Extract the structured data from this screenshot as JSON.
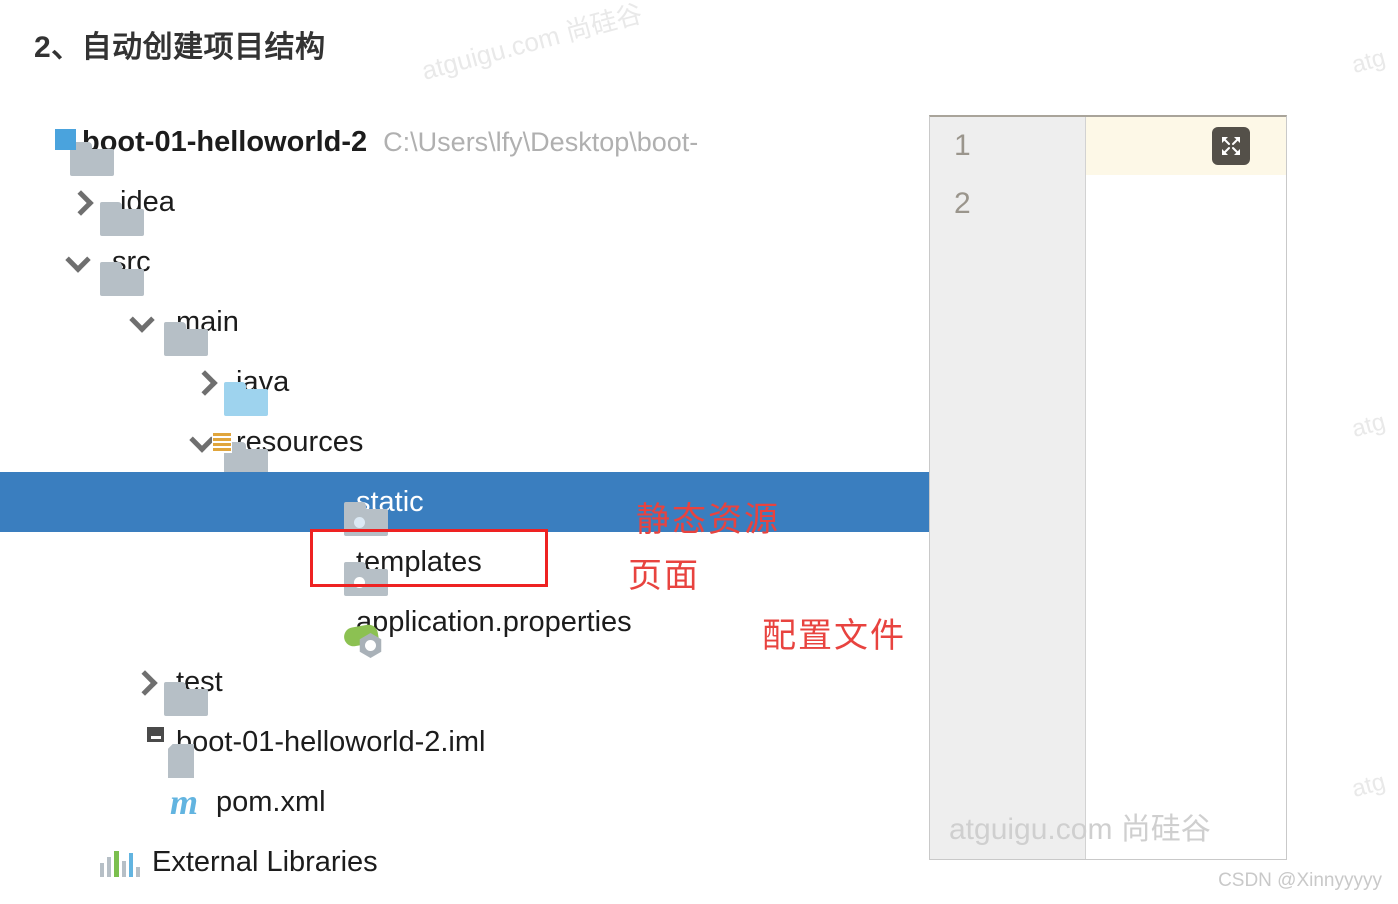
{
  "heading": "2、自动创建项目结构",
  "watermarks": {
    "top": "atguigu.com 尚硅谷",
    "right1": "atg",
    "right2": "atg",
    "right3": "atg",
    "editor": "atguigu.com 尚硅谷",
    "csdn": "CSDN @Xinnyyyyy"
  },
  "project_tree": {
    "root": {
      "label": "boot-01-helloworld-2",
      "path": "C:\\Users\\lfy\\Desktop\\boot-",
      "icon": "folder-module-icon",
      "expanded": true
    },
    "nodes": [
      {
        "label": ".idea",
        "icon": "folder-icon",
        "chevron": "right",
        "indent": 1,
        "selected": false
      },
      {
        "label": "src",
        "icon": "folder-icon",
        "chevron": "down",
        "indent": 1,
        "selected": false
      },
      {
        "label": "main",
        "icon": "folder-icon",
        "chevron": "down",
        "indent": 2,
        "selected": false
      },
      {
        "label": "java",
        "icon": "folder-source-icon",
        "chevron": "right",
        "indent": 3,
        "selected": false
      },
      {
        "label": "resources",
        "icon": "folder-resources-icon",
        "chevron": "down",
        "indent": 3,
        "selected": false
      },
      {
        "label": "static",
        "icon": "folder-package-icon",
        "chevron": "none",
        "indent": 5,
        "selected": true
      },
      {
        "label": "templates",
        "icon": "folder-package-icon",
        "chevron": "none",
        "indent": 5,
        "selected": false
      },
      {
        "label": "application.properties",
        "icon": "spring-boot-icon",
        "chevron": "none",
        "indent": 5,
        "selected": false
      },
      {
        "label": "test",
        "icon": "folder-icon",
        "chevron": "right",
        "indent": 2,
        "selected": false
      },
      {
        "label": "boot-01-helloworld-2.iml",
        "icon": "iml-file-icon",
        "chevron": "none",
        "indent": 2,
        "selected": false
      },
      {
        "label": "pom.xml",
        "icon": "maven-icon",
        "chevron": "none",
        "indent": 2,
        "selected": false
      },
      {
        "label": "External Libraries",
        "icon": "libraries-bars-icon",
        "chevron": "none",
        "indent": 1,
        "selected": false
      }
    ]
  },
  "annotations": {
    "static_note": "静态资源",
    "templates_note": "页面",
    "properties_note": "配置文件",
    "highlight_color": "#ee2222",
    "selection_color": "#3a7ebf"
  },
  "editor_panel": {
    "lines": [
      {
        "number": "1",
        "text": ""
      },
      {
        "number": "2",
        "text": ""
      }
    ],
    "expand_button_icon": "expand-icon"
  }
}
